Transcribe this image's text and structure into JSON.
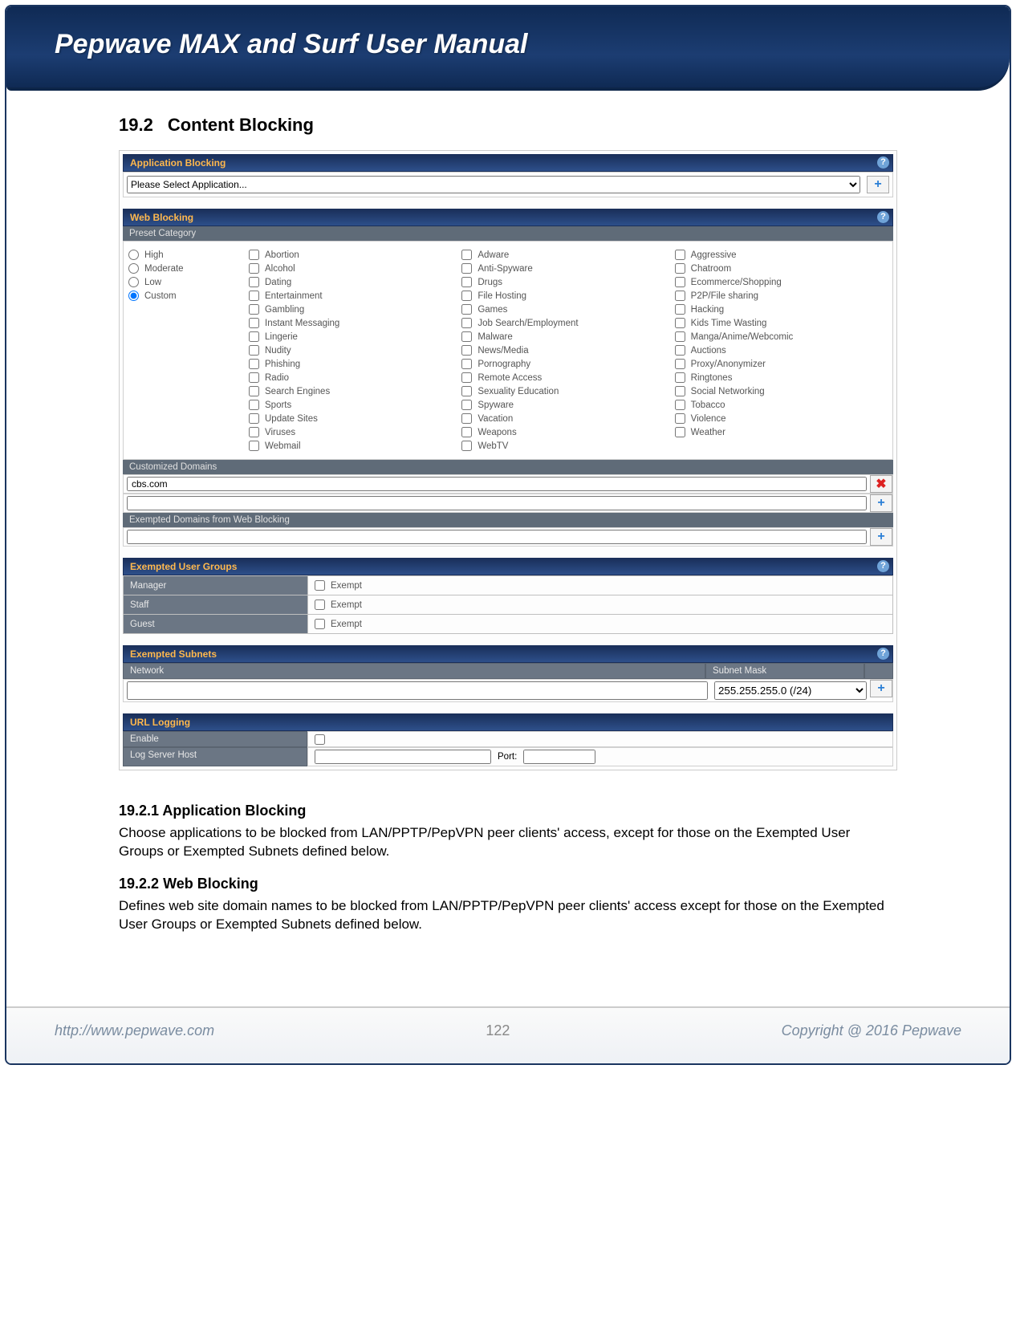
{
  "header": {
    "title": "Pepwave MAX and Surf User Manual"
  },
  "section": {
    "number": "19.2",
    "title": "Content Blocking"
  },
  "app_blocking": {
    "panel_title": "Application Blocking",
    "select_placeholder": "Please Select Application..."
  },
  "web_blocking": {
    "panel_title": "Web Blocking",
    "preset_label": "Preset Category",
    "levels": [
      "High",
      "Moderate",
      "Low",
      "Custom"
    ],
    "columns": [
      [
        "Abortion",
        "Alcohol",
        "Dating",
        "Entertainment",
        "Gambling",
        "Instant Messaging",
        "Lingerie",
        "Nudity",
        "Phishing",
        "Radio",
        "Search Engines",
        "Sports",
        "Update Sites",
        "Viruses",
        "Webmail"
      ],
      [
        "Adware",
        "Anti-Spyware",
        "Drugs",
        "File Hosting",
        "Games",
        "Job Search/Employment",
        "Malware",
        "News/Media",
        "Pornography",
        "Remote Access",
        "Sexuality Education",
        "Spyware",
        "Vacation",
        "Weapons",
        "WebTV"
      ],
      [
        "Aggressive",
        "Chatroom",
        "Ecommerce/Shopping",
        "P2P/File sharing",
        "Hacking",
        "Kids Time Wasting",
        "Manga/Anime/Webcomic",
        "Auctions",
        "Proxy/Anonymizer",
        "Ringtones",
        "Social Networking",
        "Tobacco",
        "Violence",
        "Weather"
      ]
    ],
    "custom_domains_label": "Customized Domains",
    "custom_domain_value": "cbs.com",
    "exempted_domains_label": "Exempted Domains from Web Blocking"
  },
  "exempt_groups": {
    "panel_title": "Exempted User Groups",
    "rows": [
      "Manager",
      "Staff",
      "Guest"
    ],
    "exempt_label": "Exempt"
  },
  "exempt_subnets": {
    "panel_title": "Exempted Subnets",
    "network_label": "Network",
    "mask_label": "Subnet Mask",
    "mask_value": "255.255.255.0 (/24)"
  },
  "url_logging": {
    "panel_title": "URL Logging",
    "enable_label": "Enable",
    "host_label": "Log Server Host",
    "port_label": "Port:"
  },
  "subsections": {
    "s1_num": "19.2.1",
    "s1_title": "Application Blocking",
    "s1_body": "Choose applications to be blocked from LAN/PPTP/PepVPN peer clients' access, except for those on the Exempted User Groups or Exempted Subnets defined below.",
    "s2_num": "19.2.2",
    "s2_title": "Web Blocking",
    "s2_body": "Defines web site domain names to be blocked from LAN/PPTP/PepVPN peer clients' access except for those on the Exempted User Groups or Exempted Subnets defined below."
  },
  "footer": {
    "url": "http://www.pepwave.com",
    "page": "122",
    "copyright": "Copyright @ 2016 Pepwave"
  },
  "help": "?"
}
